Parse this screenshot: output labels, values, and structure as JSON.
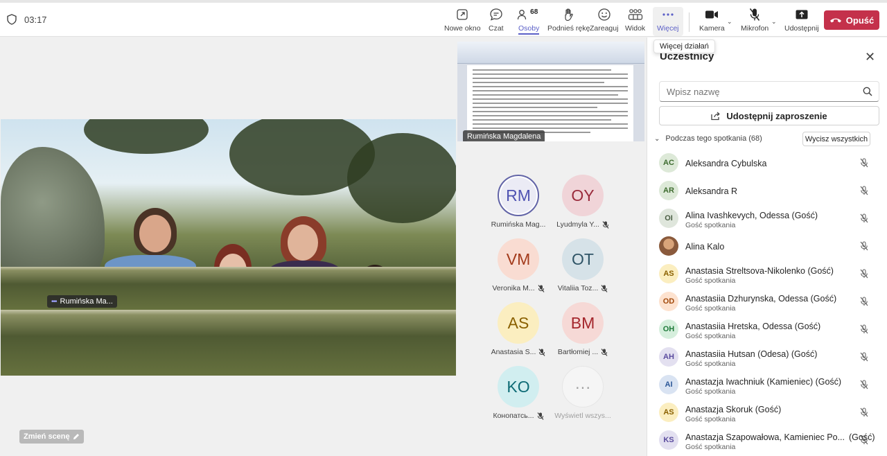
{
  "header": {
    "timer": "03:17",
    "toolbar": [
      {
        "label": "Nowe okno",
        "icon": "new-window-icon"
      },
      {
        "label": "Czat",
        "icon": "chat-icon"
      },
      {
        "label": "Osoby",
        "icon": "people-icon",
        "count": "68"
      },
      {
        "label": "Podnieś rękę",
        "icon": "raise-hand-icon"
      },
      {
        "label": "Zareaguj",
        "icon": "react-icon"
      },
      {
        "label": "Widok",
        "icon": "view-icon"
      },
      {
        "label": "Więcej",
        "icon": "more-icon"
      },
      {
        "label": "Kamera",
        "icon": "camera-icon"
      },
      {
        "label": "Mikrofon",
        "icon": "microphone-off-icon"
      },
      {
        "label": "Udostępnij",
        "icon": "share-icon"
      }
    ],
    "leave_label": "Opuść",
    "tooltip": "Więcej działań"
  },
  "stage": {
    "main_video_label": "Rumińska Ma...",
    "share_label": "Rumińska Magdalena",
    "scene_button": "Zmień scenę",
    "tiles": [
      {
        "initials": "RM",
        "name": "Rumińska Mag...",
        "bg": "#ebebf5",
        "fg": "#4f52b2"
      },
      {
        "initials": "OY",
        "name": "Lyudmyla Y...",
        "bg": "#f0d4d8",
        "fg": "#9a2b3c"
      },
      {
        "initials": "VM",
        "name": "Veronika M...",
        "bg": "#f9dcd2",
        "fg": "#a33b1c"
      },
      {
        "initials": "OT",
        "name": "Vitaliia Toz...",
        "bg": "#d6e2e8",
        "fg": "#2f5466"
      },
      {
        "initials": "AS",
        "name": "Anastasia S...",
        "bg": "#fbeec0",
        "fg": "#8a6000"
      },
      {
        "initials": "BM",
        "name": "Bartłomiej ...",
        "bg": "#f6d9d6",
        "fg": "#a4262c"
      },
      {
        "initials": "KO",
        "name": "Конопатсь...",
        "bg": "#d1eef0",
        "fg": "#0e6b75"
      },
      {
        "initials": "···",
        "name": "Wyświetl wszys...",
        "bg": "#f5f5f5",
        "fg": "#9e9e9e"
      }
    ]
  },
  "panel": {
    "title": "Uczestnicy",
    "search_placeholder": "Wpisz nazwę",
    "invite_label": "Udostępnij zaproszenie",
    "section_label": "Podczas tego spotkania (68)",
    "mute_all_label": "Wycisz wszystkich",
    "participants": [
      {
        "initials": "AC",
        "name": "Aleksandra Cybulska",
        "sub": "",
        "bg": "#dde9d8",
        "fg": "#3d6b2e"
      },
      {
        "initials": "AR",
        "name": "Aleksandra R",
        "sub": "",
        "bg": "#dde9d8",
        "fg": "#3d6b2e"
      },
      {
        "initials": "OI",
        "name": "Alina Ivashkevych, Odessa (Gość)",
        "sub": "Gość spotkania",
        "bg": "#dfe6dc",
        "fg": "#4a5e43"
      },
      {
        "initials": "",
        "name": "Alina Kalo",
        "sub": "",
        "bg": "#8a5a3c",
        "fg": "#ffffff"
      },
      {
        "initials": "AS",
        "name": "Anastasia Streltsova-Nikolenko (Gość)",
        "sub": "Gość spotkania",
        "bg": "#fbeec0",
        "fg": "#8a6000"
      },
      {
        "initials": "OD",
        "name": "Anastasiia Dzhurynska, Odessa (Gość)",
        "sub": "Gość spotkania",
        "bg": "#fde2cf",
        "fg": "#a24a0c"
      },
      {
        "initials": "OH",
        "name": "Anastasiia Hretska, Odessa (Gość)",
        "sub": "Gość spotkania",
        "bg": "#d6efdd",
        "fg": "#1f7a3a"
      },
      {
        "initials": "AH",
        "name": "Anastasiia Hutsan (Odesa) (Gość)",
        "sub": "Gość spotkania",
        "bg": "#e3e0f0",
        "fg": "#5a4b9e"
      },
      {
        "initials": "AI",
        "name": "Anastazja Iwachniuk (Kamieniec) (Gość)",
        "sub": "Gość spotkania",
        "bg": "#d9e3f2",
        "fg": "#2b5797"
      },
      {
        "initials": "AS",
        "name": "Anastazja Skoruk (Gość)",
        "sub": "Gość spotkania",
        "bg": "#fbeec0",
        "fg": "#8a6000"
      },
      {
        "initials": "KS",
        "name": "Anastazja Szapowałowa, Kamieniec Po...",
        "suffix": "(Gość)",
        "sub": "Gość spotkania",
        "bg": "#e3e0f0",
        "fg": "#5a4b9e"
      }
    ]
  }
}
